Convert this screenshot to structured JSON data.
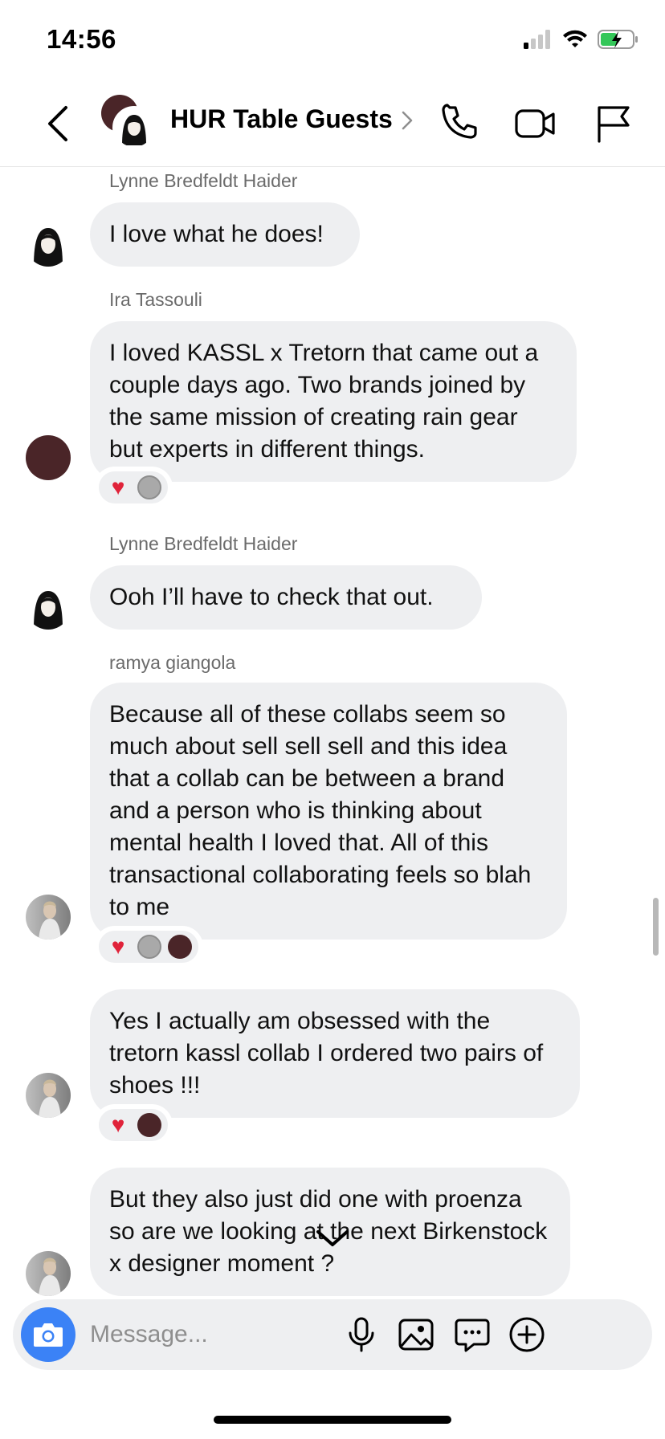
{
  "status_bar": {
    "time": "14:56"
  },
  "header": {
    "title": "HUR Table Guests"
  },
  "messages": [
    {
      "sender": "Lynne Bredfeldt Haider",
      "text": "I love what he does!"
    },
    {
      "sender": "Ira Tassouli",
      "text": "I loved KASSL x Tretorn that came out a couple days ago. Two brands joined by the same mission of creating rain gear but experts in different things."
    },
    {
      "sender": "Lynne Bredfeldt Haider",
      "text": "Ooh I’ll have to check that out."
    },
    {
      "sender": "ramya giangola",
      "text": "Because all of these collabs seem so much about sell sell sell and this idea that a collab can be between a brand and a person who is thinking about mental health I loved that. All of this transactional collaborating feels so blah to me"
    },
    {
      "sender": "",
      "text": "Yes I actually am obsessed with the tretorn kassl collab I ordered two pairs of shoes !!!"
    },
    {
      "sender": "",
      "text": "But they also just did one with proenza so are we looking at the next Birkenstock x designer moment ?"
    }
  ],
  "composer": {
    "placeholder": "Message..."
  },
  "colors": {
    "accent": "#3b82f6",
    "bubble": "#eeeff1",
    "heart": "#e0233a",
    "maroon_avatar": "#4a2528"
  }
}
